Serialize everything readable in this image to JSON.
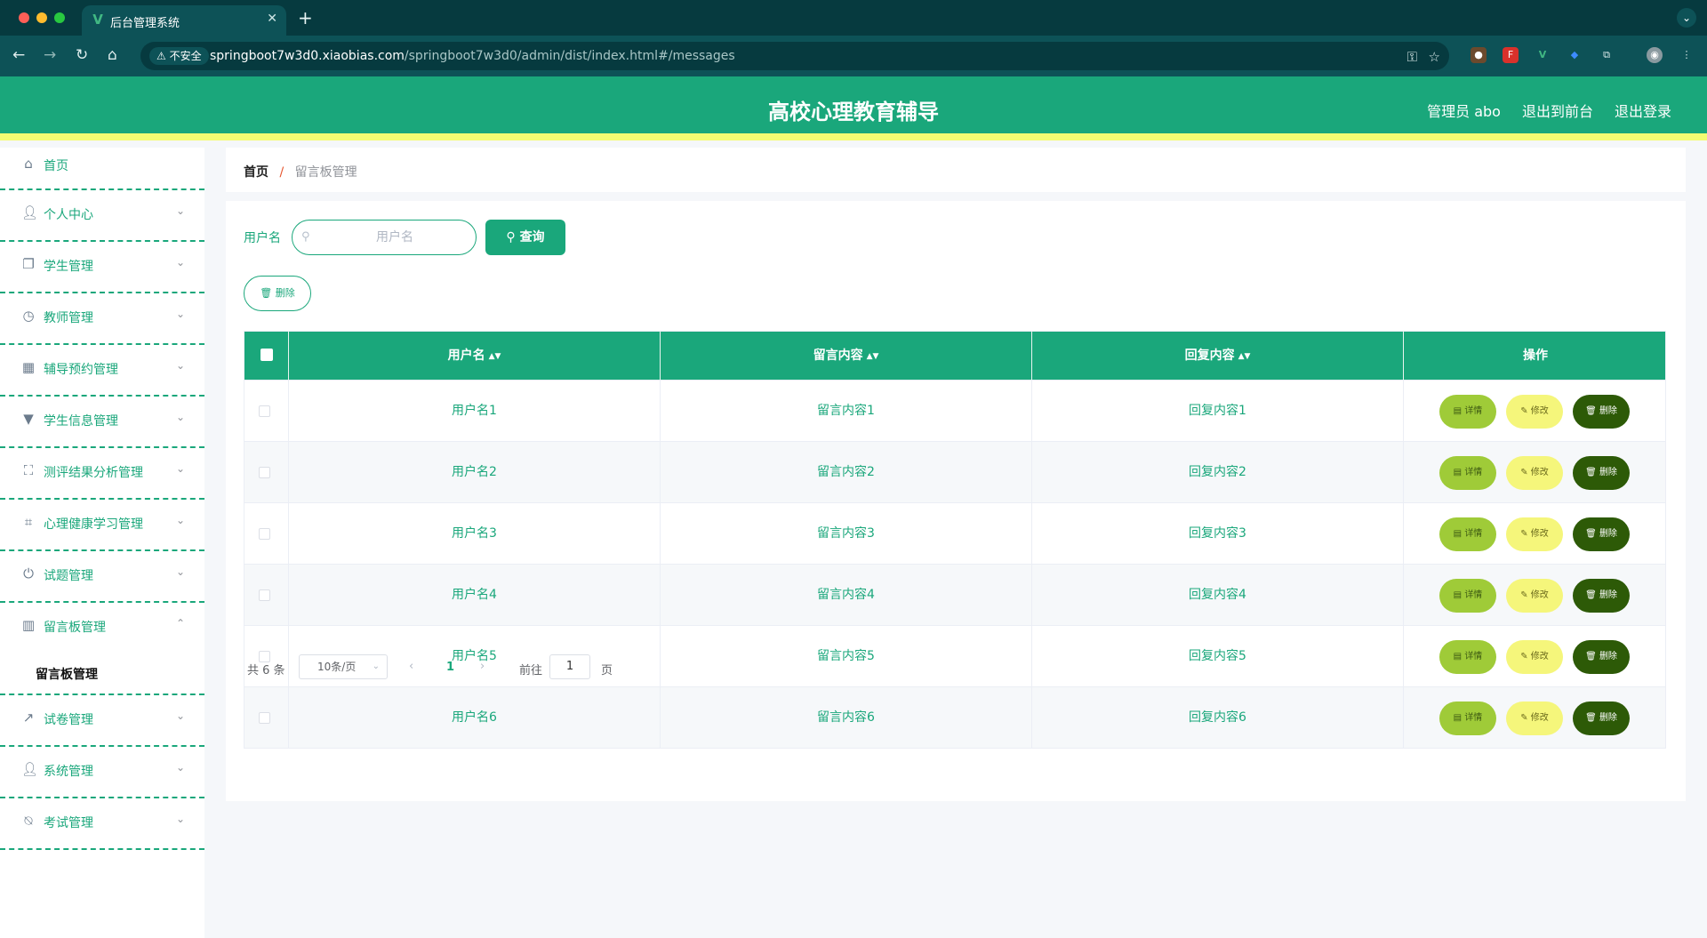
{
  "browser": {
    "tab_title": "后台管理系统",
    "tab_favicon": "V",
    "insecure_label": "不安全",
    "url_host": "springboot7w3d0.xiaobias.com",
    "url_path": "/springboot7w3d0/admin/dist/index.html#/messages"
  },
  "header": {
    "title": "高校心理教育辅导",
    "user_label": "管理员 abo",
    "front_link": "退出到前台",
    "logout_link": "退出登录"
  },
  "sidebar": {
    "items": [
      {
        "label": "首页",
        "icon": "home-icon"
      },
      {
        "label": "个人中心",
        "icon": "user-icon"
      },
      {
        "label": "学生管理",
        "icon": "copy-icon"
      },
      {
        "label": "教师管理",
        "icon": "clock-icon"
      },
      {
        "label": "辅导预约管理",
        "icon": "grid-icon"
      },
      {
        "label": "学生信息管理",
        "icon": "brush-icon"
      },
      {
        "label": "测评结果分析管理",
        "icon": "fullscreen-icon"
      },
      {
        "label": "心理健康学习管理",
        "icon": "crop-icon"
      },
      {
        "label": "试题管理",
        "icon": "power-icon"
      },
      {
        "label": "留言板管理",
        "icon": "chart-bar-icon"
      },
      {
        "label": "试卷管理",
        "icon": "chart-line-icon"
      },
      {
        "label": "系统管理",
        "icon": "user-icon"
      },
      {
        "label": "考试管理",
        "icon": "bell-off-icon"
      }
    ],
    "sub_active": "留言板管理"
  },
  "breadcrumb": {
    "home": "首页",
    "separator": "/",
    "current": "留言板管理"
  },
  "search": {
    "label": "用户名",
    "placeholder": "用户名",
    "value": "",
    "query_button": "查询",
    "bulk_delete_button": "删除"
  },
  "table": {
    "columns": [
      "用户名",
      "留言内容",
      "回复内容",
      "操作"
    ],
    "rows": [
      {
        "username": "用户名1",
        "content": "留言内容1",
        "reply": "回复内容1"
      },
      {
        "username": "用户名2",
        "content": "留言内容2",
        "reply": "回复内容2"
      },
      {
        "username": "用户名3",
        "content": "留言内容3",
        "reply": "回复内容3"
      },
      {
        "username": "用户名4",
        "content": "留言内容4",
        "reply": "回复内容4"
      },
      {
        "username": "用户名5",
        "content": "留言内容5",
        "reply": "回复内容5"
      },
      {
        "username": "用户名6",
        "content": "留言内容6",
        "reply": "回复内容6"
      }
    ],
    "actions": {
      "detail": "详情",
      "edit": "修改",
      "delete": "删除"
    }
  },
  "pagination": {
    "total": "共 6 条",
    "page_size": "10条/页",
    "current_page": "1",
    "goto_label": "前往",
    "goto_value": "1",
    "goto_unit": "页"
  },
  "colors": {
    "primary": "#1aa77b",
    "header_accent": "#f4fc72",
    "detail_button": "#9fcb38",
    "edit_button": "#f5f67b",
    "delete_button": "#2d5a07"
  }
}
